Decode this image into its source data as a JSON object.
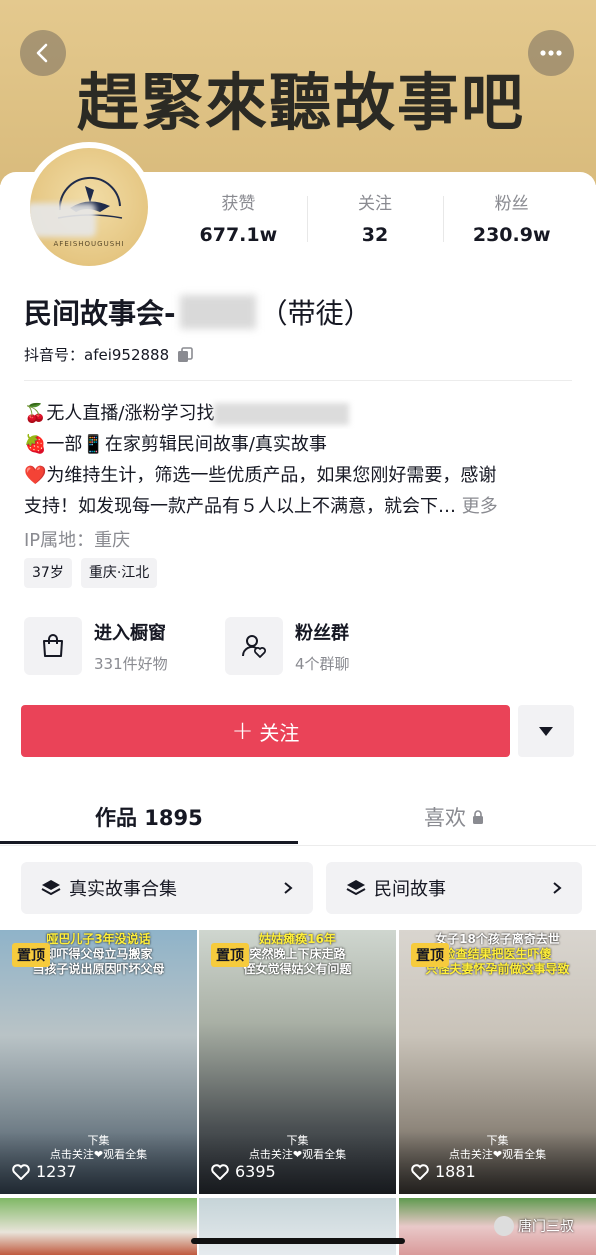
{
  "banner": {
    "title": "趕緊來聽故事吧"
  },
  "avatar": {
    "caption": "AFEISHOUGUSHI"
  },
  "stats": [
    {
      "label": "获赞",
      "value": "677.1w"
    },
    {
      "label": "关注",
      "value": "32"
    },
    {
      "label": "粉丝",
      "value": "230.9w"
    }
  ],
  "profile": {
    "name_prefix": "民间故事会-",
    "name_suffix": "（带徒）",
    "id_label": "抖音号：",
    "id_value": "afei952888"
  },
  "bio": {
    "line1": "🍒无人直播/涨粉学习找",
    "line2": "🍓一部📱在家剪辑民间故事/真实故事",
    "line3": "❤️为维持生计，筛选一些优质产品，如果您刚好需要，感谢",
    "line4": "支持！如发现每一款产品有５人以上不满意，就会下…",
    "more": "更多"
  },
  "ip": "IP属地：重庆",
  "tags": [
    "37岁",
    "重庆·江北"
  ],
  "shortcuts": [
    {
      "title": "进入橱窗",
      "sub": "331件好物",
      "icon": "shopping-bag-icon"
    },
    {
      "title": "粉丝群",
      "sub": "4个群聊",
      "icon": "fan-group-icon"
    }
  ],
  "follow": {
    "label": "关注"
  },
  "tabs": {
    "works": "作品 1895",
    "likes": "喜欢"
  },
  "collections": [
    "真实故事合集",
    "民间故事"
  ],
  "videos": [
    {
      "pin": "置顶",
      "caption_top1": "哑巴儿子3年没说话",
      "caption_top2": "却吓得父母立马搬家",
      "caption_top3": "当孩子说出原因吓坏父母",
      "caption_bottom1": "下集",
      "caption_bottom2": "点击关注❤观看全集",
      "likes": "1237"
    },
    {
      "pin": "置顶",
      "caption_top1": "姑姑瘫痪16年",
      "caption_top2": "突然晚上下床走路",
      "caption_top3": "侄女觉得姑父有问题",
      "caption_bottom1": "下集",
      "caption_bottom2": "点击关注❤观看全集",
      "likes": "6395"
    },
    {
      "pin": "置顶",
      "caption_top1": "女子18个孩子离奇去世",
      "caption_top2": "检查结果把医生吓傻",
      "caption_top3": "只怪夫妻怀孕前做这事导致",
      "caption_bottom1": "下集",
      "caption_bottom2": "点击关注❤观看全集",
      "likes": "1881"
    }
  ],
  "watermark": "唐门三叔",
  "colors": {
    "accent": "#ea4358",
    "banner": "#e0c485",
    "pin": "#f6cb3d"
  }
}
